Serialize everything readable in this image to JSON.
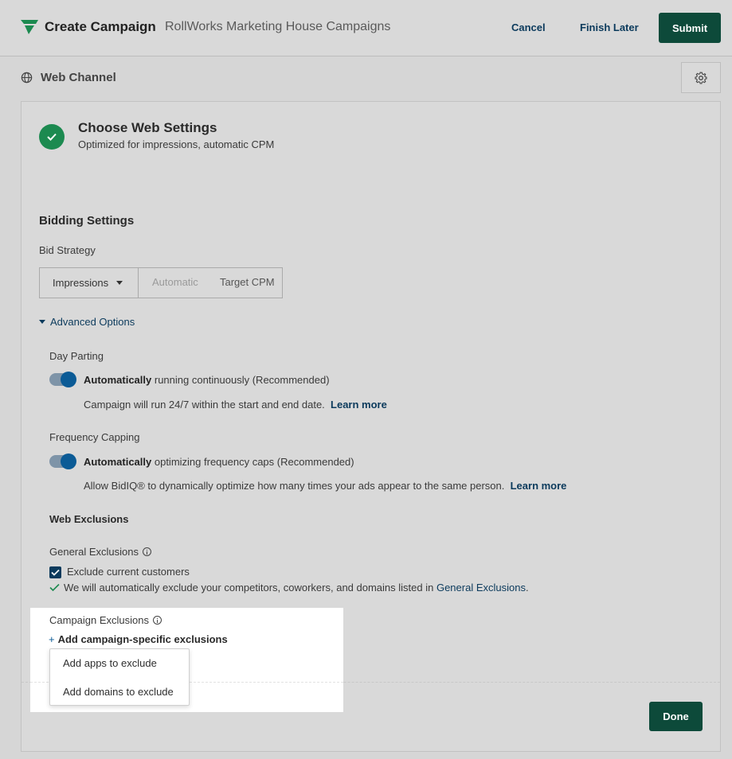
{
  "header": {
    "title": "Create Campaign",
    "campaign_name": "RollWorks Marketing House Campaigns",
    "cancel_label": "Cancel",
    "finish_later_label": "Finish Later",
    "submit_label": "Submit"
  },
  "channel": {
    "title": "Web Channel",
    "icon": "globe-icon",
    "settings_icon": "gear-icon"
  },
  "step": {
    "title": "Choose Web Settings",
    "subtitle": "Optimized for impressions, automatic CPM",
    "status_icon": "check-icon"
  },
  "bidding": {
    "section_title": "Bidding Settings",
    "strategy_label": "Bid Strategy",
    "strategy_value": "Impressions",
    "automatic_label": "Automatic",
    "target_cpm_label": "Target CPM"
  },
  "advanced": {
    "toggle_label": "Advanced Options",
    "day_parting": {
      "label": "Day Parting",
      "enabled": true,
      "bold_text": "Automatically",
      "text": " running continuously (Recommended)",
      "description": "Campaign will run 24/7 within the start and end date.",
      "learn_more": "Learn more"
    },
    "frequency": {
      "label": "Frequency Capping",
      "enabled": true,
      "bold_text": "Automatically",
      "text": " optimizing frequency caps (Recommended)",
      "description": "Allow BidIQ® to dynamically optimize how many times your ads appear to the same person.",
      "learn_more": "Learn more"
    }
  },
  "exclusions": {
    "section_title": "Web Exclusions",
    "general_label": "General Exclusions",
    "exclude_customers_label": "Exclude current customers",
    "exclude_customers_checked": true,
    "auto_note_prefix": "We will automatically exclude your competitors, coworkers, and domains listed in ",
    "auto_note_link": "General Exclusions",
    "auto_note_suffix": ".",
    "campaign_label": "Campaign Exclusions",
    "add_label": "Add campaign-specific exclusions",
    "menu": {
      "add_apps": "Add apps to exclude",
      "add_domains": "Add domains to exclude"
    }
  },
  "footer": {
    "done_label": "Done"
  },
  "colors": {
    "primary_button": "#0d4a3a",
    "link": "#0b3a5c",
    "success": "#1c8a50",
    "toggle_on": "#0b5b96"
  }
}
